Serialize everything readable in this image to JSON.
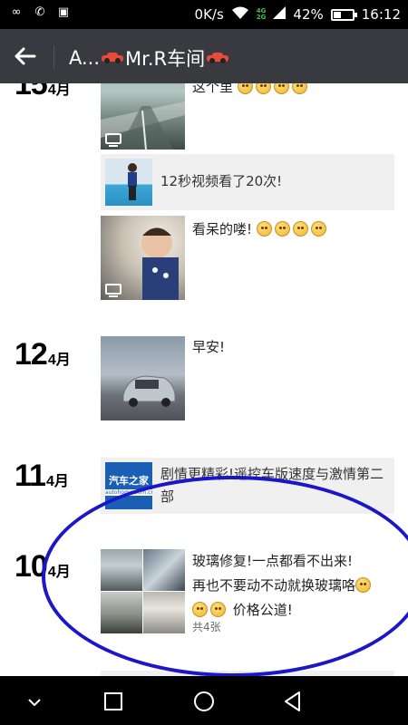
{
  "status_bar": {
    "net_speed": "0K/s",
    "network_4g": "4G",
    "network_2g": "2G",
    "battery_percent": "42%",
    "battery_level": 0.42,
    "time": "16:12"
  },
  "header": {
    "title_prefix": "A...",
    "title_name": "Mr.R车间"
  },
  "posts": [
    {
      "day": "15",
      "month": "4月",
      "items": [
        {
          "type": "video",
          "text": "这个里"
        },
        {
          "type": "share",
          "text": "12秒视频看了20次!"
        },
        {
          "type": "video",
          "text": "看呆的喽!"
        }
      ]
    },
    {
      "day": "12",
      "month": "4月",
      "items": [
        {
          "type": "photo",
          "text": "早安!"
        }
      ]
    },
    {
      "day": "11",
      "month": "4月",
      "items": [
        {
          "type": "share",
          "logo_title": "汽车之家",
          "logo_sub": "autohome.com.cn",
          "text": "剧情更精彩!遥控车版速度与激情第二部"
        }
      ]
    },
    {
      "day": "10",
      "month": "4月",
      "items": [
        {
          "type": "gallery",
          "line1": "玻璃修复!一点都看不出来!",
          "line2": "再也不要动不动就换玻璃咯",
          "line3": "价格公道!",
          "count": "共4张"
        }
      ]
    }
  ],
  "nav": {
    "icons": [
      "chevron-down-icon",
      "recent-apps-icon",
      "home-icon",
      "back-triangle-icon"
    ]
  }
}
